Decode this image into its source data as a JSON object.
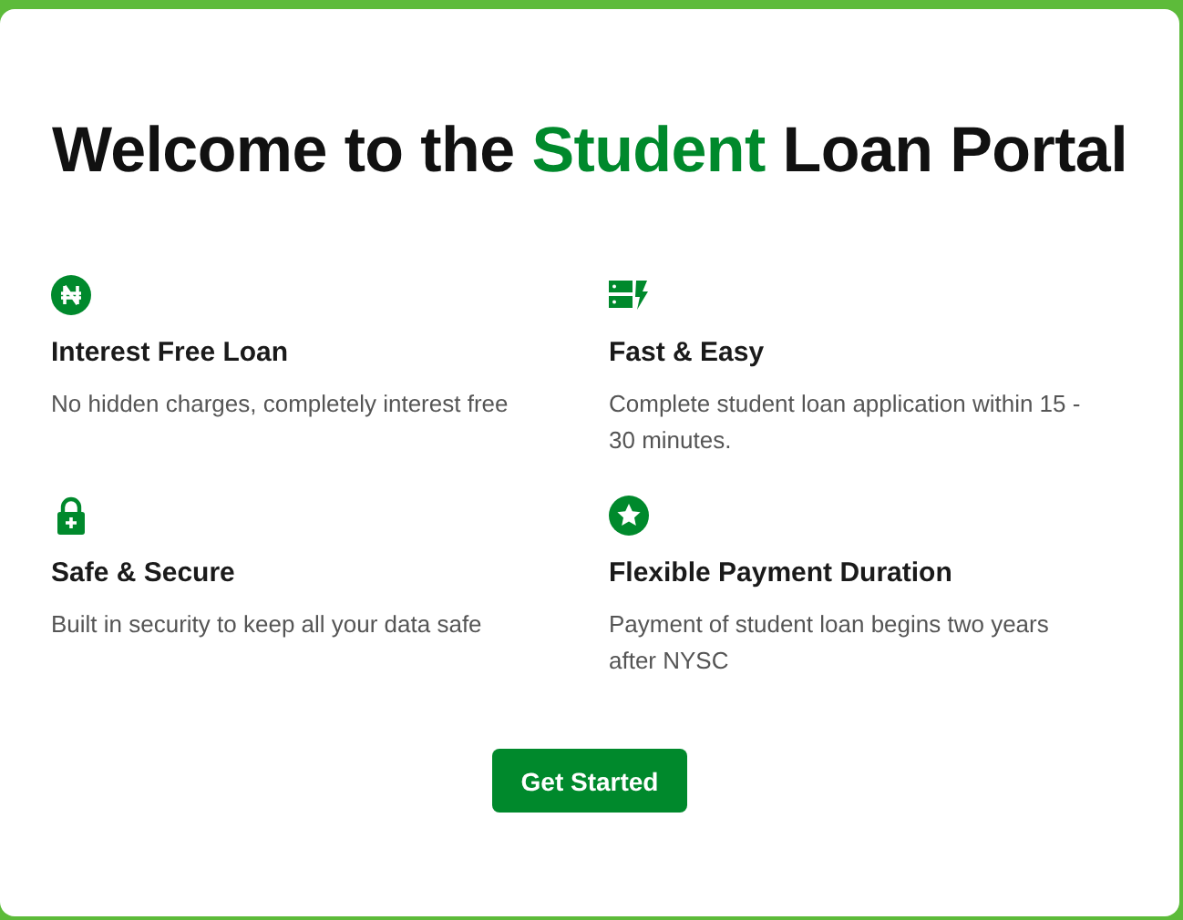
{
  "title": {
    "before": "Welcome to the",
    "highlight": "Student",
    "after": "Loan Portal"
  },
  "features": [
    {
      "title": "Interest Free Loan",
      "description": "No hidden charges, completely interest free"
    },
    {
      "title": "Fast & Easy",
      "description": "Complete student loan application within 15 - 30 minutes."
    },
    {
      "title": "Safe & Secure",
      "description": "Built in security to keep all your data safe"
    },
    {
      "title": "Flexible Payment Duration",
      "description": "Payment of student loan begins two years after NYSC"
    }
  ],
  "button": {
    "label": "Get Started"
  }
}
